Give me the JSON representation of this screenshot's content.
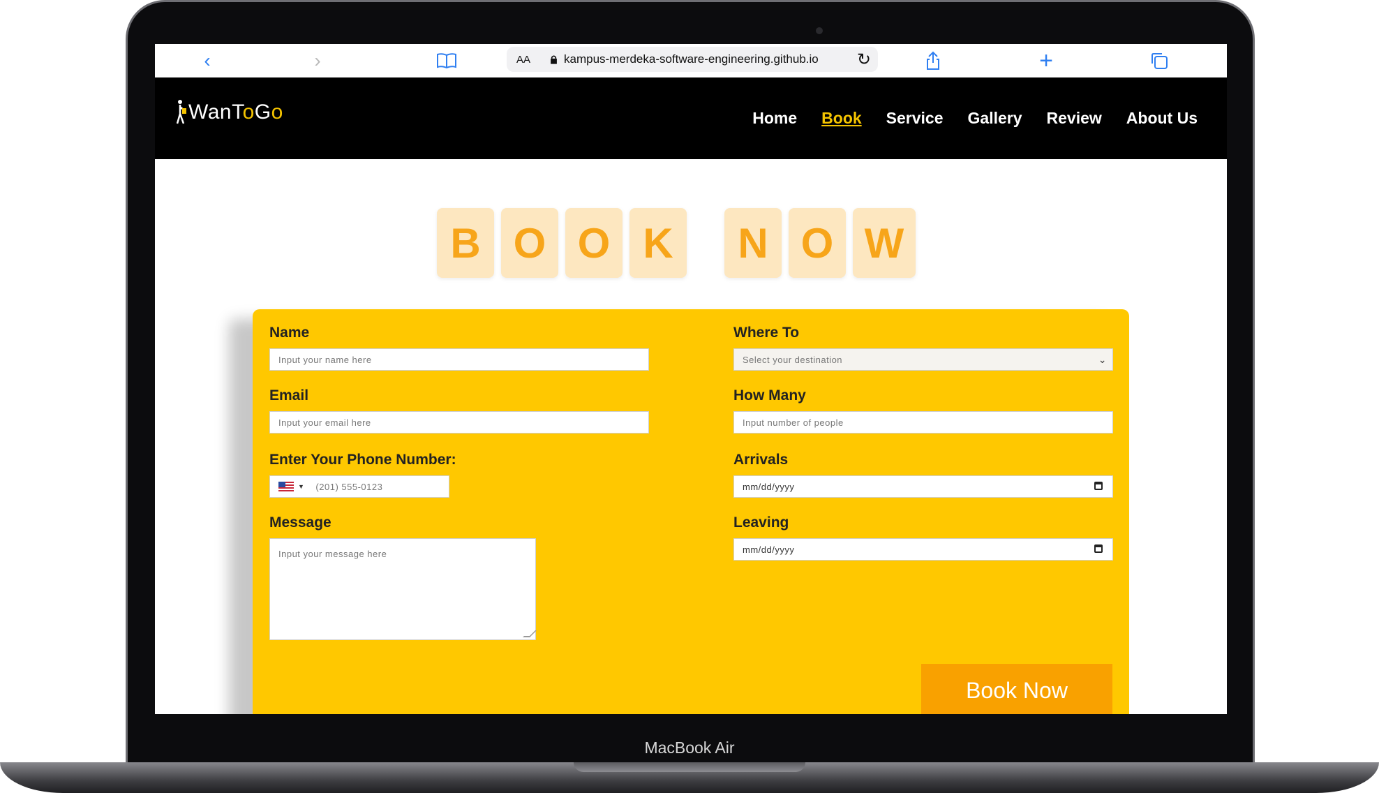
{
  "device": {
    "model_label": "MacBook Air"
  },
  "browser": {
    "url": "kampus-merdeka-software-engineering.github.io",
    "text_size_label": "AA",
    "icons": [
      "back-icon",
      "forward-icon",
      "bookmarks-icon",
      "lock-icon",
      "reload-icon",
      "share-icon",
      "new-tab-icon",
      "tabs-icon"
    ]
  },
  "navbar": {
    "logo_text": "WanToGo",
    "links": [
      {
        "label": "Home",
        "active": false
      },
      {
        "label": "Book",
        "active": true
      },
      {
        "label": "Service",
        "active": false
      },
      {
        "label": "Gallery",
        "active": false
      },
      {
        "label": "Review",
        "active": false
      },
      {
        "label": "About Us",
        "active": false
      }
    ]
  },
  "heading": {
    "words": [
      "BOOK",
      "NOW"
    ]
  },
  "form": {
    "name": {
      "label": "Name",
      "placeholder": "Input your name here"
    },
    "email": {
      "label": "Email",
      "placeholder": "Input your email here"
    },
    "phone": {
      "label": "Enter Your Phone Number:",
      "placeholder": "(201) 555-0123",
      "country_flag": "US"
    },
    "message": {
      "label": "Message",
      "placeholder": "Input your message here"
    },
    "where_to": {
      "label": "Where To",
      "placeholder": "Select your destination"
    },
    "how_many": {
      "label": "How Many",
      "placeholder": "Input number of people"
    },
    "arrivals": {
      "label": "Arrivals",
      "placeholder": "mm/dd/yyyy"
    },
    "leaving": {
      "label": "Leaving",
      "placeholder": "mm/dd/yyyy"
    },
    "submit_label": "Book Now"
  },
  "colors": {
    "accent_yellow": "#ffc800",
    "brand_yellow": "#f5c400",
    "button_orange": "#f9a100",
    "tile_bg": "#fde7c0",
    "tile_text": "#f7a51a",
    "navbar_bg": "#000000"
  }
}
